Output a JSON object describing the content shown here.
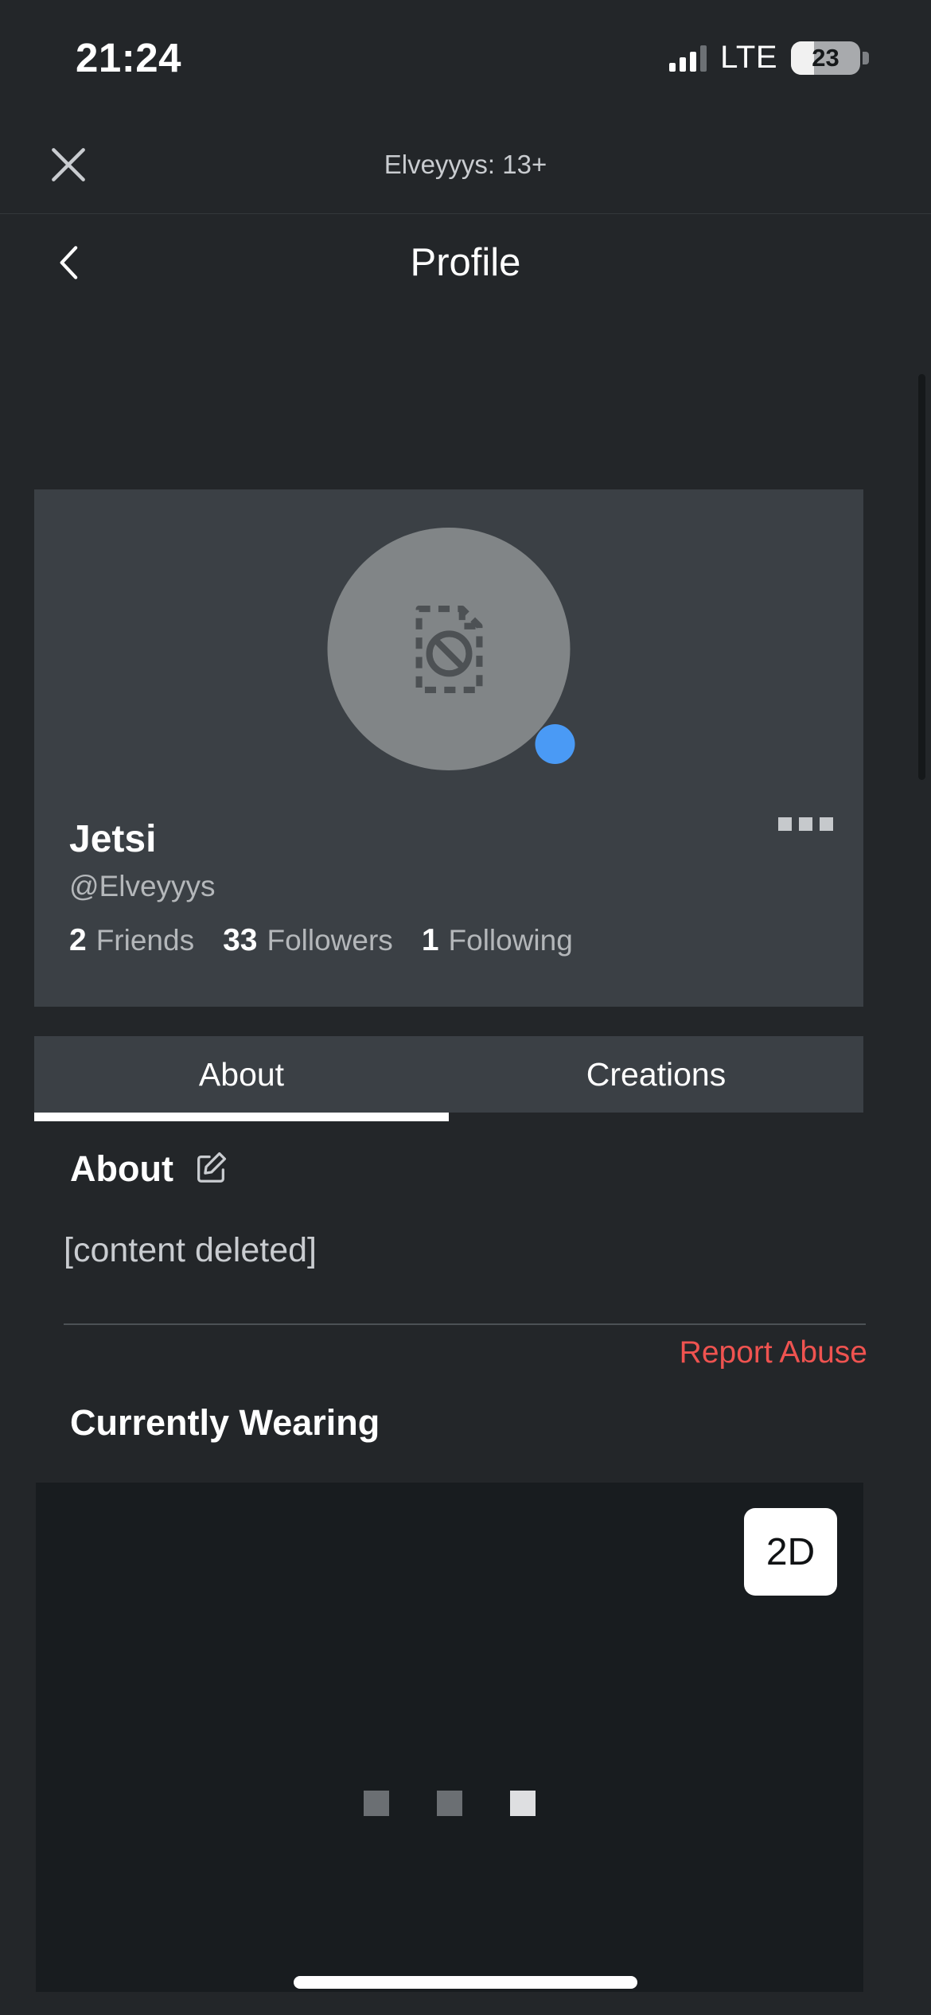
{
  "status_bar": {
    "time": "21:24",
    "network_label": "LTE",
    "battery_percent": "23",
    "signal_icon": "signal-bars-icon",
    "battery_icon": "battery-icon"
  },
  "app_bar": {
    "close_icon": "close-icon",
    "title": "Elveyyys: 13+"
  },
  "nav_bar": {
    "back_icon": "chevron-left-icon",
    "title": "Profile"
  },
  "profile": {
    "avatar_icon": "broken-image-placeholder-icon",
    "status_indicator": "online-status-dot",
    "display_name": "Jetsi",
    "handle": "@Elveyyys",
    "more_icon": "more-options-icon",
    "stats": [
      {
        "count": "2",
        "label": "Friends"
      },
      {
        "count": "33",
        "label": "Followers"
      },
      {
        "count": "1",
        "label": "Following"
      }
    ]
  },
  "tabs": [
    {
      "label": "About",
      "active": true
    },
    {
      "label": "Creations",
      "active": false
    }
  ],
  "about": {
    "heading": "About",
    "edit_icon": "edit-pencil-icon",
    "content": "[content deleted]",
    "report_label": "Report Abuse"
  },
  "currently_wearing": {
    "heading": "Currently Wearing",
    "view_toggle_label": "2D",
    "loading_indicator": "loading-squares-indicator"
  },
  "colors": {
    "page_background": "#232629",
    "card_background": "#3b4045",
    "panel_background": "#181c1f",
    "accent_blue": "#4a9af5",
    "danger_red": "#ef5350",
    "text_primary": "#ffffff",
    "text_secondary": "#b4b7ba"
  }
}
